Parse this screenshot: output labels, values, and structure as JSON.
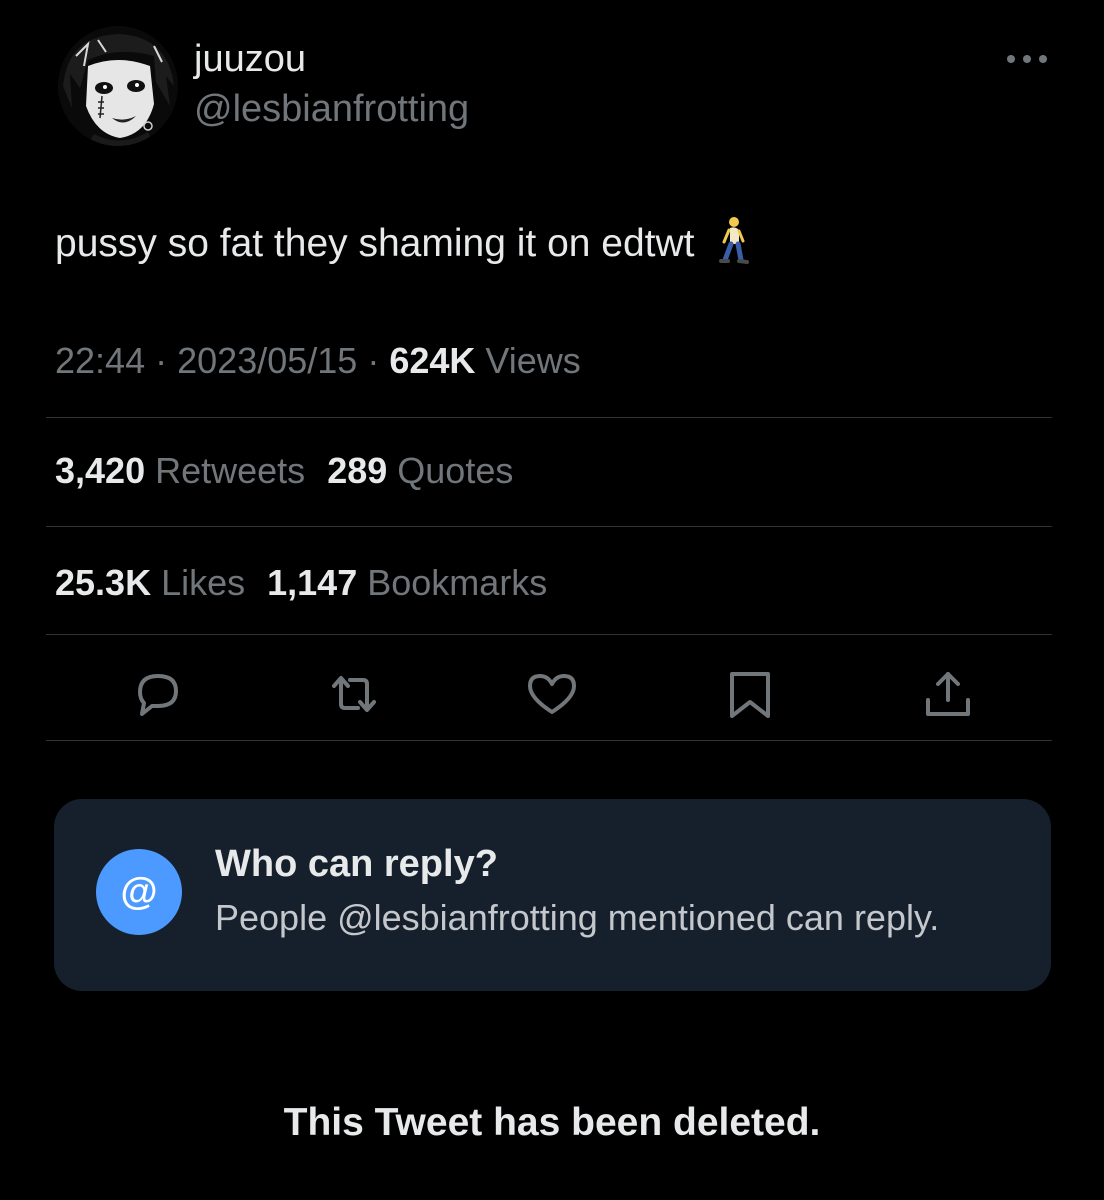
{
  "author": {
    "display_name": "juuzou",
    "handle": "@lesbianfrotting",
    "avatar_icon": "anime-avatar"
  },
  "tweet": {
    "text": "pussy so fat they shaming it on edtwt",
    "emoji": "person-walking-emoji"
  },
  "meta": {
    "time": "22:44",
    "separator": "·",
    "date": "2023/05/15",
    "views_count": "624K",
    "views_label": "Views"
  },
  "stats": {
    "retweets_count": "3,420",
    "retweets_label": "Retweets",
    "quotes_count": "289",
    "quotes_label": "Quotes",
    "likes_count": "25.3K",
    "likes_label": "Likes",
    "bookmarks_count": "1,147",
    "bookmarks_label": "Bookmarks"
  },
  "actions": [
    "reply-icon",
    "retweet-icon",
    "like-icon",
    "bookmark-icon",
    "share-icon"
  ],
  "reply_settings": {
    "icon_symbol": "@",
    "title": "Who can reply?",
    "subtitle": "People @lesbianfrotting mentioned can reply."
  },
  "footer": {
    "deleted_notice": "This Tweet has been deleted."
  },
  "colors": {
    "background": "#000000",
    "primary_text": "#e7e9ea",
    "secondary_text": "#71767b",
    "divider": "#2f3336",
    "reply_box": "#16202c",
    "accent": "#4c9aff"
  }
}
